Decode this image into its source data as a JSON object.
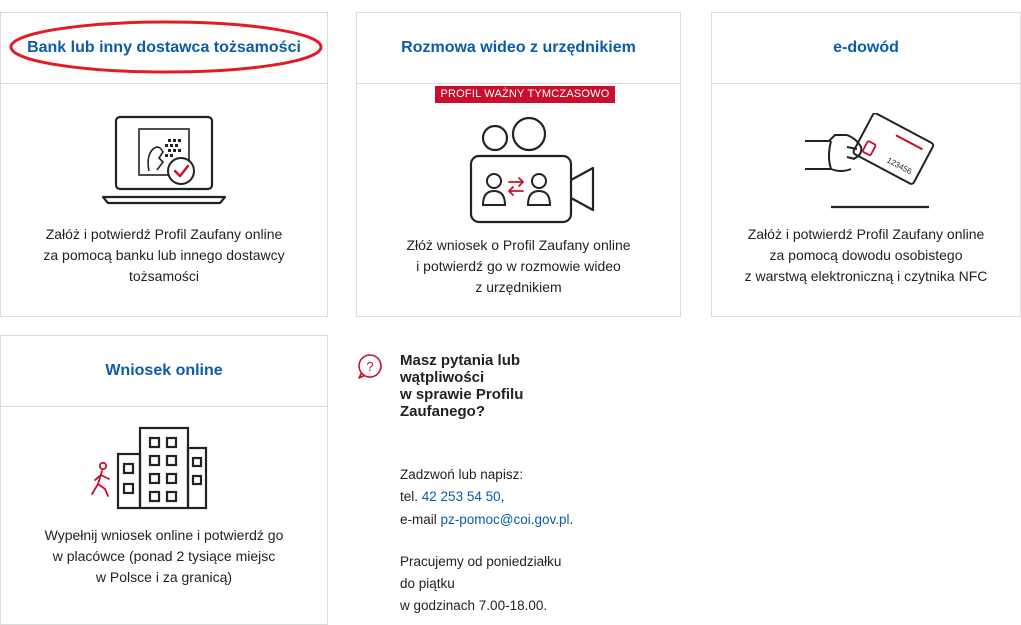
{
  "cards": [
    {
      "title": "Bank lub inny dostawca tożsamości",
      "desc": [
        "Załóż i potwierdź Profil Zaufany online",
        "za pomocą banku lub innego dostawcy",
        "tożsamości"
      ]
    },
    {
      "title": "Rozmowa wideo z urzędnikiem",
      "badge": "PROFIL WAŻNY TYMCZASOWO",
      "desc": [
        "Złóż wniosek o Profil Zaufany online",
        "i potwierdź go w rozmowie wideo",
        "z urzędnikiem"
      ]
    },
    {
      "title": "e-dowód",
      "card_number": "123456",
      "desc": [
        "Załóż i potwierdź Profil Zaufany online",
        "za pomocą dowodu osobistego",
        "z warstwą elektroniczną i czytnika NFC"
      ]
    },
    {
      "title": "Wniosek online",
      "desc": [
        "Wypełnij wniosek online i potwierdź go",
        "w placówce (ponad 2 tysiące miejsc",
        "w Polsce i za granicą)"
      ]
    }
  ],
  "help": {
    "title": [
      "Masz pytania lub",
      "wątpliwości",
      "w sprawie Profilu",
      "Zaufanego?"
    ],
    "contact_intro": "Zadzwoń lub napisz:",
    "tel_label": "tel.",
    "tel_value": "42 253 54 50",
    "tel_suffix": ",",
    "email_label": "e-mail",
    "email_value": "pz-pomoc@coi.gov.pl",
    "email_suffix": ".",
    "hours": [
      "Pracujemy od poniedziałku",
      "do piątku",
      "w godzinach 7.00-18.00."
    ]
  },
  "colors": {
    "link": "#0b5cab",
    "accent_red": "#c8102e",
    "border": "#dcdcdc"
  },
  "icons": [
    "laptop-identity-icon",
    "video-call-icon",
    "e-id-card-icon",
    "building-walk-icon",
    "question-bubble-icon"
  ]
}
